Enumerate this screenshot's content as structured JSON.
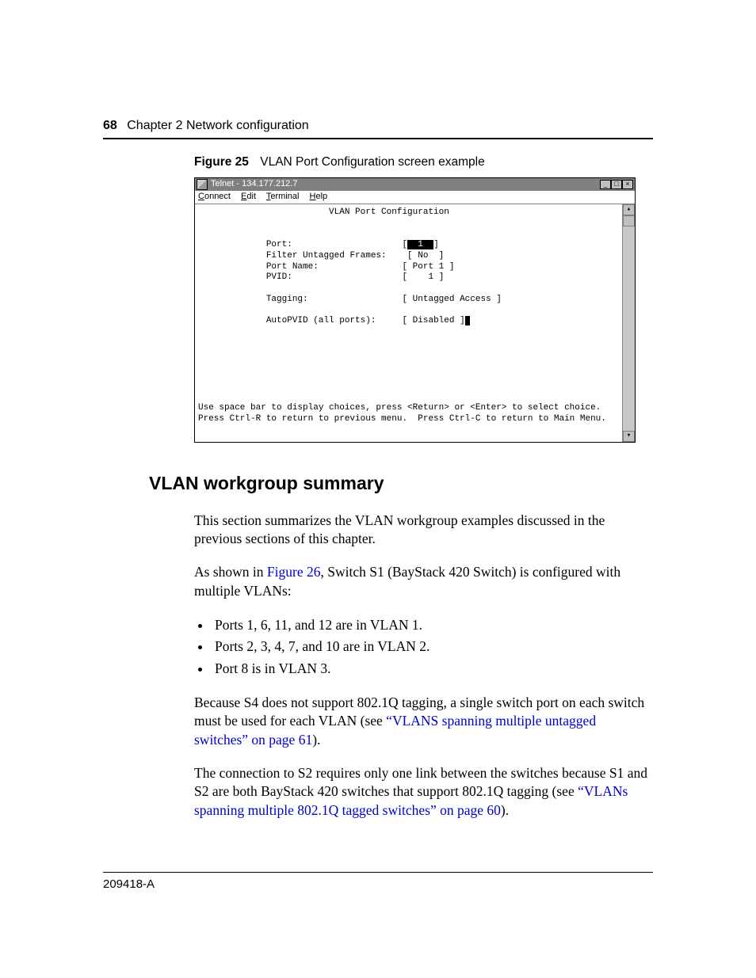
{
  "header": {
    "page_number": "68",
    "chapter": "Chapter 2  Network configuration"
  },
  "figure": {
    "label": "Figure 25",
    "caption": "VLAN Port Configuration screen example"
  },
  "telnet": {
    "title": "Telnet - 134.177.212.7",
    "menus": {
      "connect": "Connect",
      "edit": "Edit",
      "terminal": "Terminal",
      "help": "Help"
    },
    "screen_title": "VLAN Port Configuration",
    "fields": {
      "port_label": "Port:",
      "port_value": "1",
      "filter_label": "Filter Untagged Frames:",
      "filter_value": "No",
      "portname_label": "Port Name:",
      "portname_value": "Port 1",
      "pvid_label": "PVID:",
      "pvid_value": "1",
      "tagging_label": "Tagging:",
      "tagging_value": "Untagged Access",
      "autopvid_label": "AutoPVID (all ports):",
      "autopvid_value": "Disabled"
    },
    "help1": "Use space bar to display choices, press <Return> or <Enter> to select choice.",
    "help2": "Press Ctrl-R to return to previous menu.  Press Ctrl-C to return to Main Menu."
  },
  "section": {
    "heading": "VLAN workgroup summary",
    "p1": "This section summarizes the VLAN workgroup examples discussed in the previous sections of this chapter.",
    "p2a": "As shown in ",
    "p2_link": "Figure 26",
    "p2b": ", Switch S1 (BayStack 420 Switch) is configured with multiple VLANs:",
    "bullets": [
      "Ports 1, 6, 11, and 12 are in VLAN 1.",
      "Ports 2, 3, 4, 7, and 10 are in VLAN 2.",
      "Port 8 is in VLAN 3."
    ],
    "p3a": "Because S4 does not support 802.1Q tagging, a single switch port on each switch must be used for each VLAN (see ",
    "p3_link": "“VLANS spanning multiple untagged switches” on page 61",
    "p3b": ").",
    "p4a": "The connection to S2 requires only one link between the switches because S1 and S2 are both BayStack 420 switches that support 802.1Q tagging (see ",
    "p4_link": "“VLANs spanning multiple 802.1Q tagged switches” on page 60",
    "p4b": ")."
  },
  "footer": {
    "doc_id": "209418-A"
  }
}
